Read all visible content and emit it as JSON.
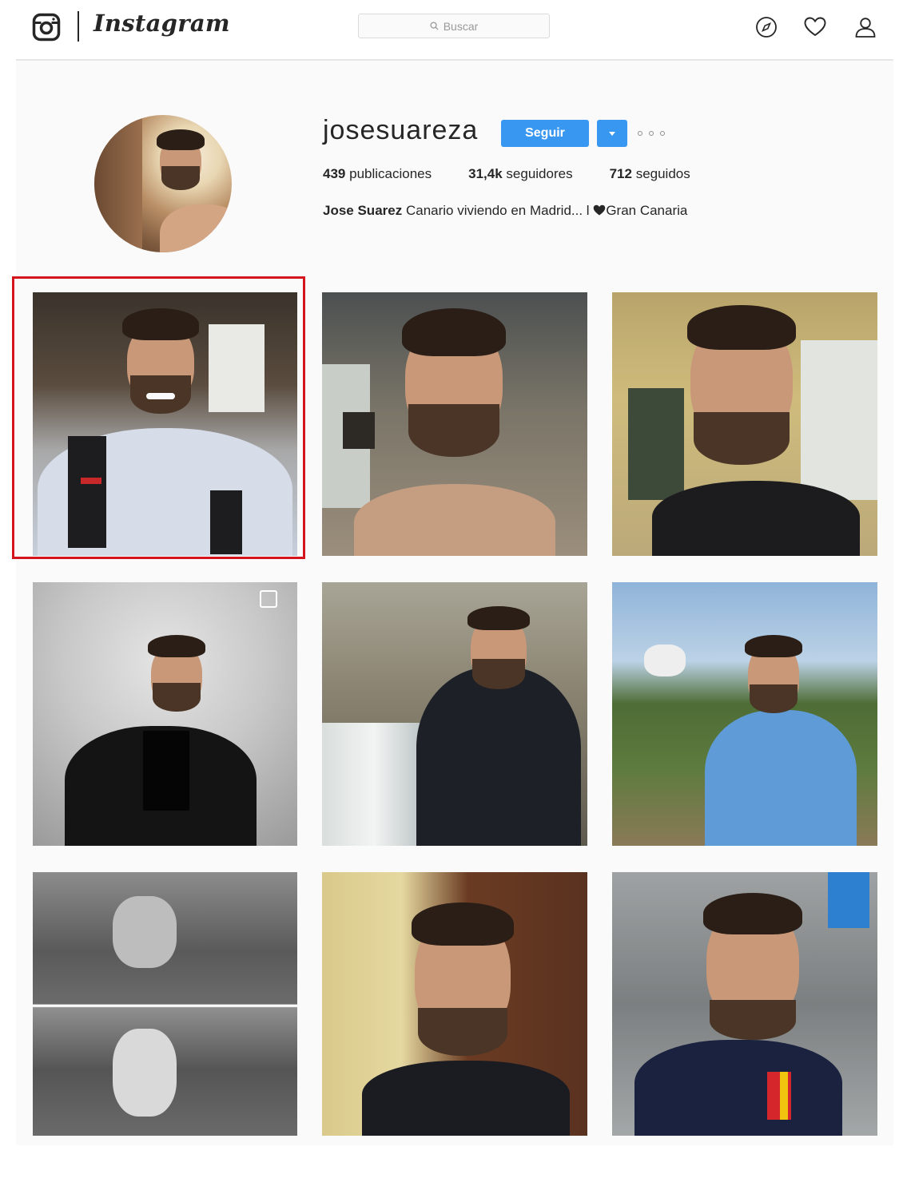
{
  "header": {
    "wordmark": "Instagram",
    "search_placeholder": "Buscar",
    "icons": [
      "instagram-glyph-icon",
      "search-icon",
      "compass-icon",
      "heart-icon",
      "user-icon"
    ]
  },
  "profile": {
    "username": "josesuareza",
    "follow_label": "Seguir",
    "stats": {
      "posts_count": "439",
      "posts_label": "publicaciones",
      "followers_count": "31,4k",
      "followers_label": "seguidores",
      "following_count": "712",
      "following_label": "seguidos"
    },
    "full_name": "Jose Suarez",
    "bio_part1": "Canario viviendo en Madrid... l ",
    "bio_part2": "Gran Canaria"
  },
  "posts": [
    {
      "id": "post-1",
      "highlighted": true
    },
    {
      "id": "post-2",
      "highlighted": false
    },
    {
      "id": "post-3",
      "highlighted": false
    },
    {
      "id": "post-4",
      "highlighted": false
    },
    {
      "id": "post-5",
      "highlighted": false
    },
    {
      "id": "post-6",
      "highlighted": false
    },
    {
      "id": "post-7",
      "highlighted": false
    },
    {
      "id": "post-8",
      "highlighted": false
    },
    {
      "id": "post-9",
      "highlighted": false
    }
  ],
  "colors": {
    "accent": "#3897f0",
    "highlight_border": "#d4151d",
    "background": "#fafafa"
  }
}
